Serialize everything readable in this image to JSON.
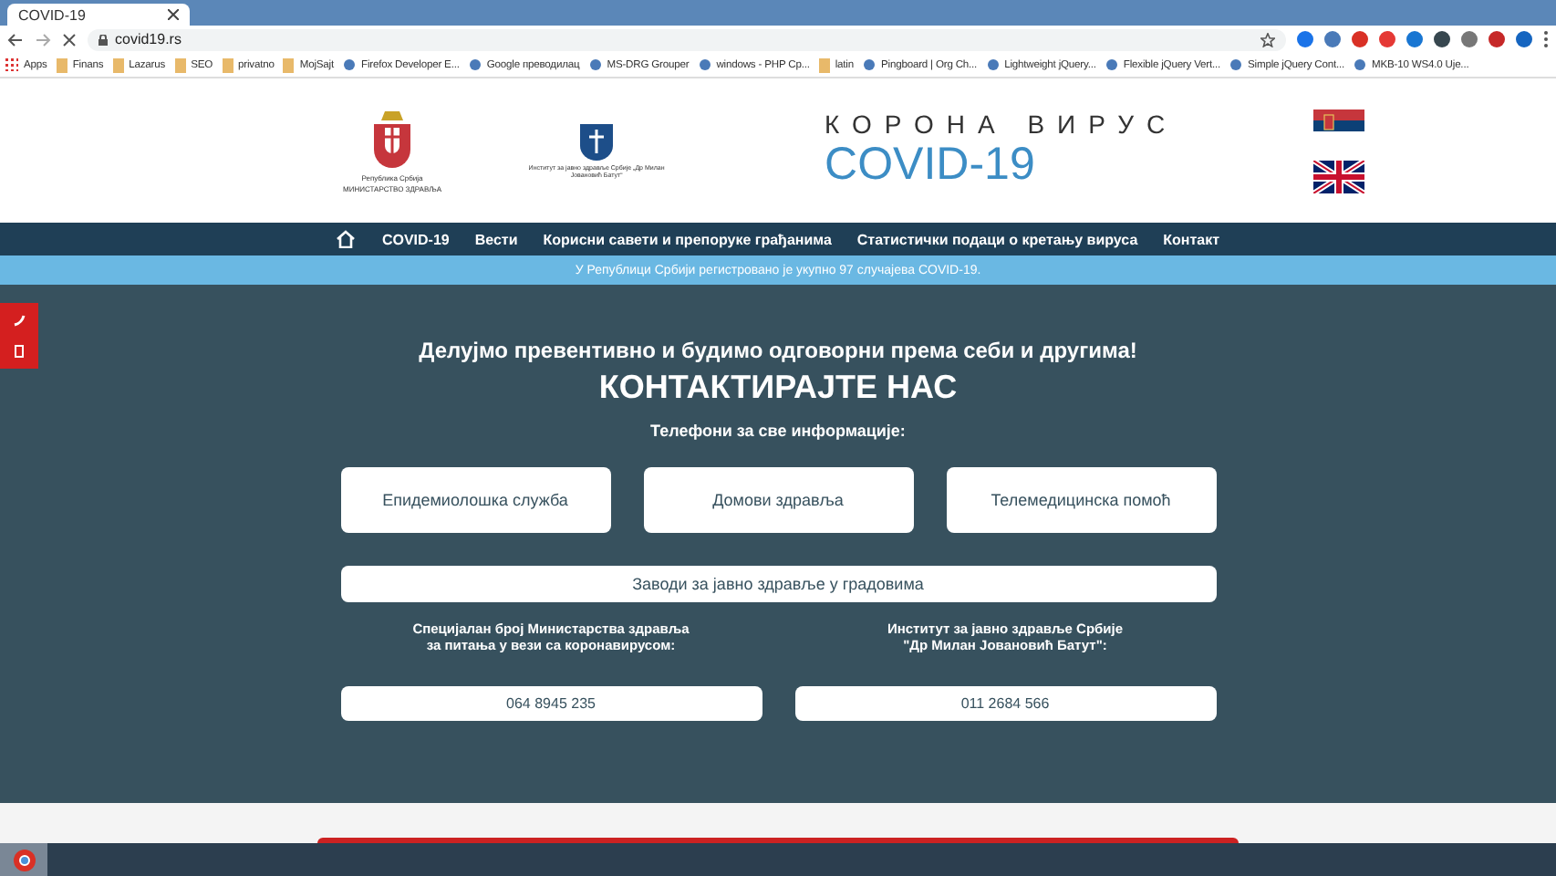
{
  "browser": {
    "tab_title": "COVID-19",
    "url": "covid19.rs",
    "bookmarks": [
      {
        "label": "Apps",
        "kind": "apps"
      },
      {
        "label": "Finans",
        "kind": "folder"
      },
      {
        "label": "Lazarus",
        "kind": "folder"
      },
      {
        "label": "SEO",
        "kind": "folder"
      },
      {
        "label": "privatno",
        "kind": "folder"
      },
      {
        "label": "MojSajt",
        "kind": "folder"
      },
      {
        "label": "Firefox Developer E...",
        "kind": "site"
      },
      {
        "label": "Google преводилац",
        "kind": "site"
      },
      {
        "label": "MS-DRG Grouper",
        "kind": "site"
      },
      {
        "label": "windows - PHP Cp...",
        "kind": "site"
      },
      {
        "label": "latin",
        "kind": "folder"
      },
      {
        "label": "Pingboard | Org Ch...",
        "kind": "site"
      },
      {
        "label": "Lightweight jQuery...",
        "kind": "site"
      },
      {
        "label": "Flexible jQuery Vert...",
        "kind": "site"
      },
      {
        "label": "Simple jQuery Cont...",
        "kind": "site"
      },
      {
        "label": "MKB-10 WS4.0 Uje...",
        "kind": "site"
      }
    ]
  },
  "header": {
    "ministry_caption_1": "Република Србија",
    "ministry_caption_2": "МИНИСТАРСТВО ЗДРАВЉА",
    "institute_caption": "Институт за јавно здравље Србије „Др Милан Јовановић Батут“",
    "overline": "КОРОНА ВИРУС",
    "title": "COVID-19",
    "languages": [
      {
        "kind": "serbian"
      },
      {
        "kind": "english"
      }
    ]
  },
  "nav": {
    "items": [
      "COVID-19",
      "Вести",
      "Корисни савети и препоруке грађанима",
      "Статистички подаци о кретању вируса",
      "Контакт"
    ]
  },
  "notice": "У Републици Србији регистровано је укупно 97 случајева COVID-19.",
  "contact": {
    "slogan": "Делујмо превентивно и будимо одговорни према себи и другима!",
    "title": "КОНТАКТИРАЈТЕ НАС",
    "subtitle": "Телефони за све информације:",
    "buttons": [
      "Епидемиолошка служба",
      "Домови здравља",
      "Телемедицинска помоћ"
    ],
    "wide_button": "Заводи за јавно здравље у градовима",
    "columns": [
      {
        "lines": [
          "Специјалан број Министарства здравља",
          "за питања у вези са коронавирусом:"
        ],
        "phone": "064 8945 235"
      },
      {
        "lines": [
          "Институт за јавно здравље Србије",
          "\"Др Милан Јовановић Батут\":"
        ],
        "phone": "011 2684 566"
      }
    ]
  }
}
